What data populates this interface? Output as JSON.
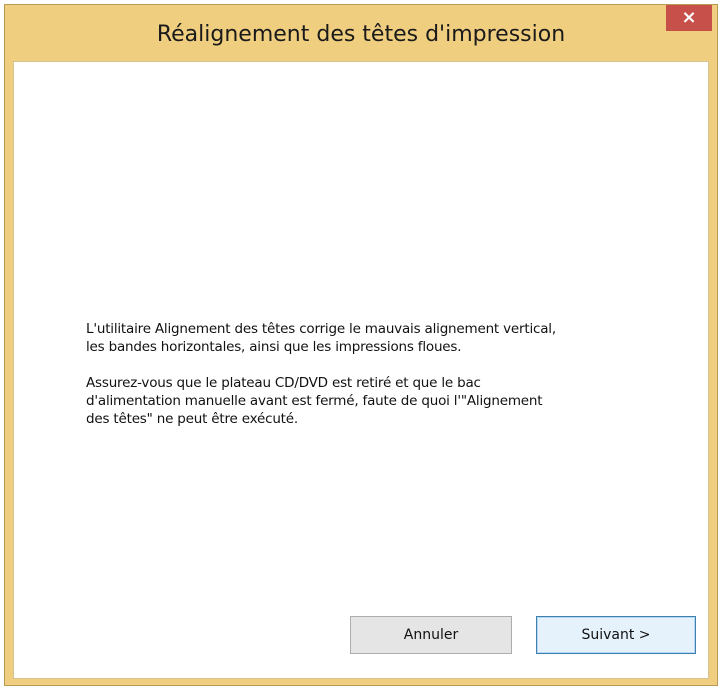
{
  "window": {
    "title": "Réalignement des têtes d'impression",
    "close_label": "×"
  },
  "content": {
    "paragraph_1": "L'utilitaire Alignement des têtes corrige le mauvais alignement vertical,\nles bandes horizontales, ainsi que les impressions floues.",
    "paragraph_2": "Assurez-vous que le plateau CD/DVD est retiré et que le bac\nd'alimentation manuelle avant est fermé, faute de quoi l'\"Alignement\ndes têtes\" ne peut être exécuté."
  },
  "buttons": {
    "cancel_label": "Annuler",
    "next_label": "Suivant >"
  },
  "colors": {
    "title_bar": "#f0ce80",
    "close_button": "#c7504a",
    "default_button_border": "#3c7fb1"
  },
  "icons": {
    "close": "close-icon"
  }
}
